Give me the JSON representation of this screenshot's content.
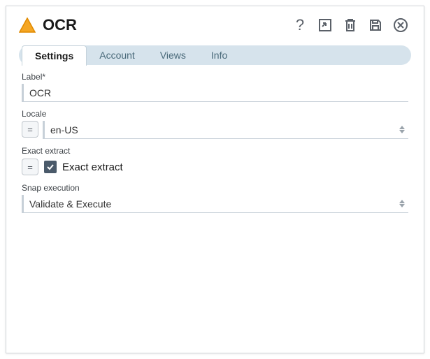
{
  "header": {
    "title": "OCR"
  },
  "tabs": {
    "items": [
      {
        "label": "Settings",
        "active": true
      },
      {
        "label": "Account",
        "active": false
      },
      {
        "label": "Views",
        "active": false
      },
      {
        "label": "Info",
        "active": false
      }
    ]
  },
  "form": {
    "label_field": {
      "label": "Label*",
      "value": "OCR"
    },
    "locale_field": {
      "label": "Locale",
      "value": "en-US",
      "eq_symbol": "="
    },
    "exact_extract_field": {
      "label": "Exact extract",
      "checkbox_label": "Exact extract",
      "checked": true,
      "eq_symbol": "="
    },
    "snap_execution_field": {
      "label": "Snap execution",
      "value": "Validate & Execute"
    }
  },
  "icons": {
    "help": "?",
    "triangle_fill": "#f5a623",
    "triangle_stroke": "#e08a00"
  }
}
